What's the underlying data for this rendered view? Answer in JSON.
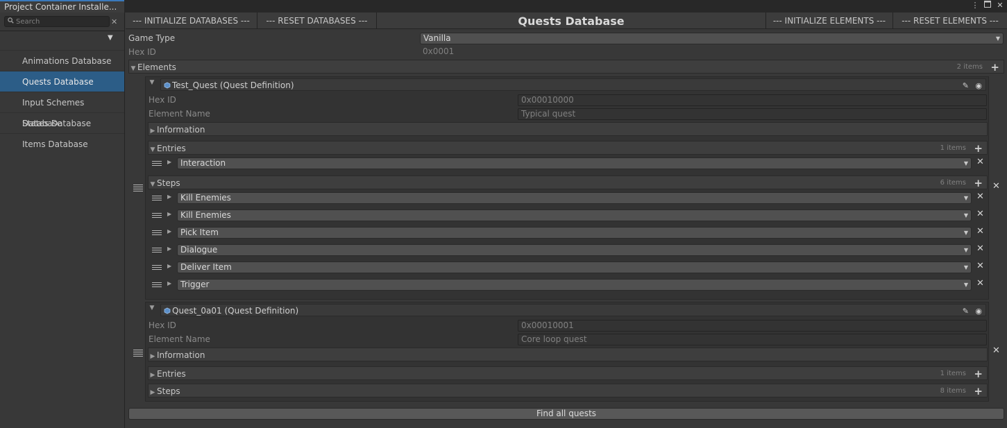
{
  "window": {
    "tab_title": "Project Container Installe...",
    "icons": [
      "more-icon",
      "maximize-icon",
      "close-icon"
    ]
  },
  "sidebar": {
    "search_placeholder": "Search",
    "items": [
      {
        "label": "Animations Database",
        "active": false
      },
      {
        "label": "Quests Database",
        "active": true
      },
      {
        "label": "Input Schemes Database",
        "active": false
      },
      {
        "label": "States Database",
        "active": false
      },
      {
        "label": "Items Database",
        "active": false
      }
    ]
  },
  "header": {
    "init_databases": "--- INITIALIZE DATABASES ---",
    "reset_databases": "--- RESET DATABASES ---",
    "title": "Quests Database",
    "init_elements": "--- INITIALIZE ELEMENTS ---",
    "reset_elements": "--- RESET ELEMENTS ---"
  },
  "game_type": {
    "label": "Game Type",
    "value": "Vanilla"
  },
  "hex_id": {
    "label": "Hex ID",
    "value": "0x0001"
  },
  "elements": {
    "label": "Elements",
    "count": "2 items",
    "items": [
      {
        "title": "Test_Quest (Quest Definition)",
        "hex_label": "Hex ID",
        "hex_value": "0x00010000",
        "name_label": "Element Name",
        "name_value": "Typical quest",
        "information": "Information",
        "entries": {
          "label": "Entries",
          "count": "1 items",
          "items": [
            "Interaction"
          ]
        },
        "steps": {
          "label": "Steps",
          "count": "6 items",
          "items": [
            "Kill Enemies",
            "Kill Enemies",
            "Pick Item",
            "Dialogue",
            "Deliver Item",
            "Trigger"
          ]
        }
      },
      {
        "title": "Quest_0a01 (Quest Definition)",
        "hex_label": "Hex ID",
        "hex_value": "0x00010001",
        "name_label": "Element Name",
        "name_value": "Core loop quest",
        "information": "Information",
        "entries": {
          "label": "Entries",
          "count": "1 items"
        },
        "steps": {
          "label": "Steps",
          "count": "8 items"
        }
      }
    ]
  },
  "footer": {
    "find_all": "Find all quests"
  },
  "colors": {
    "accent": "#2c5d87",
    "tab_accent": "#3a79bb",
    "background": "#383838"
  }
}
